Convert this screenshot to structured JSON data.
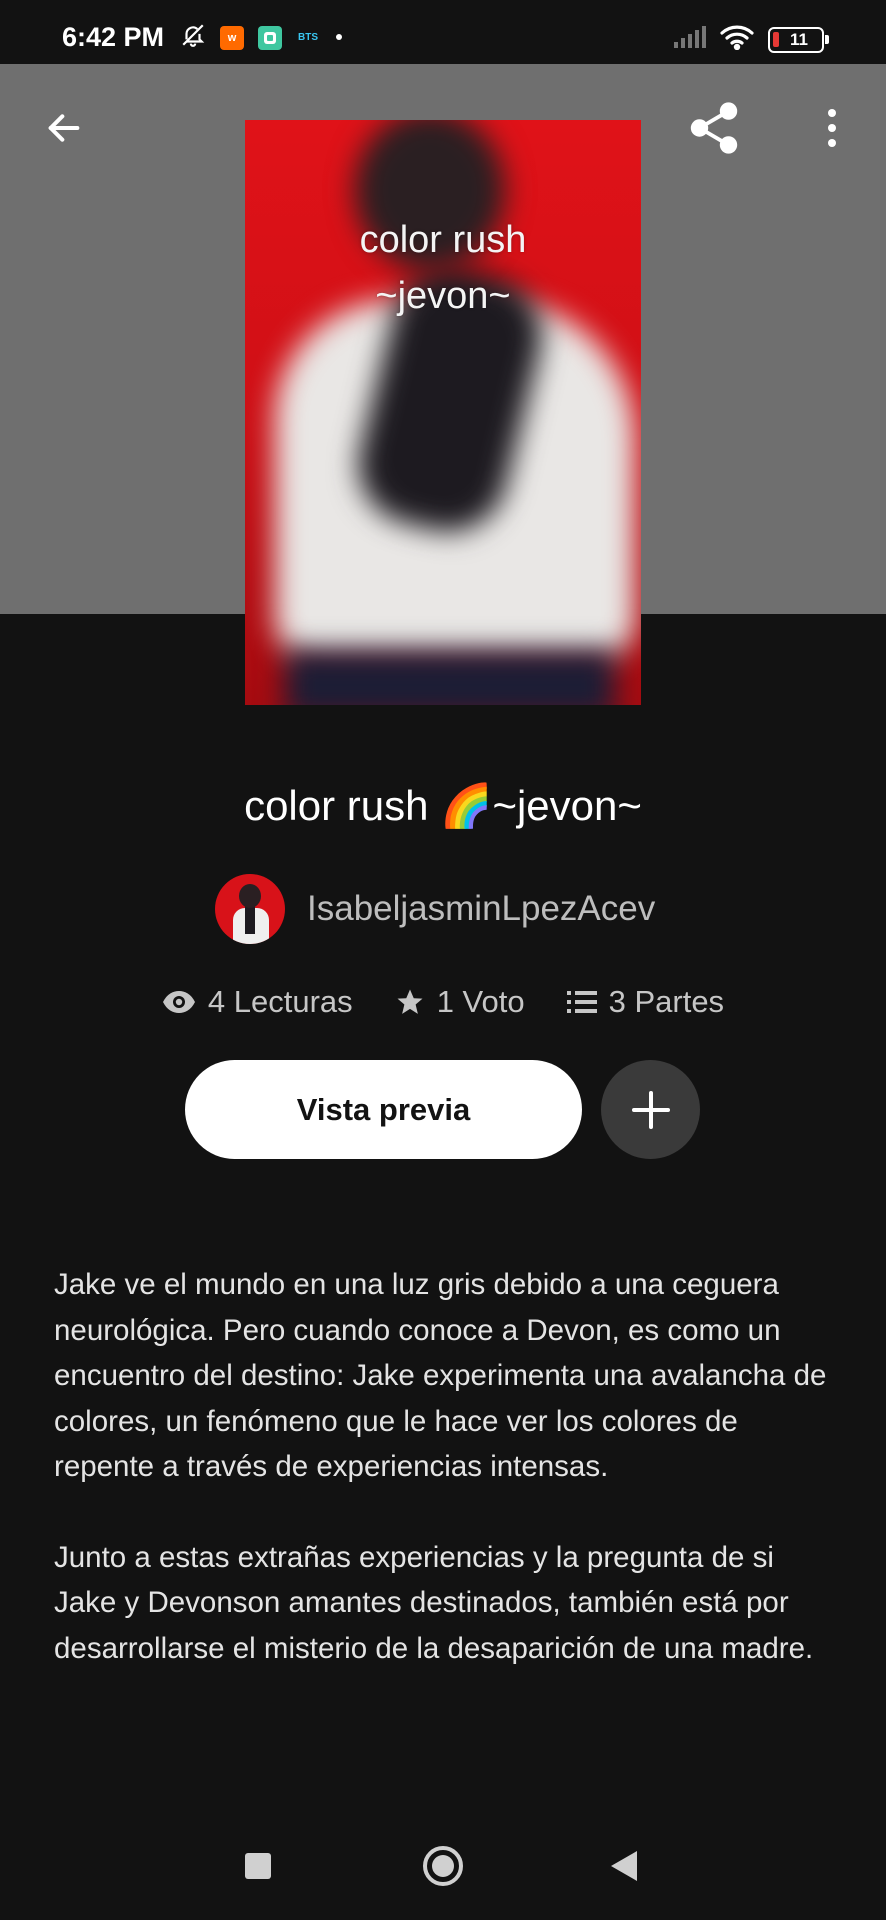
{
  "status_bar": {
    "time": "6:42 PM",
    "battery_level": "11",
    "app_icons": [
      "mute-icon",
      "app-w-icon",
      "app-green-icon",
      "bts-icon",
      "dot-icon"
    ],
    "app_w_label": "w",
    "bts_label": "BTS"
  },
  "header": {
    "back_icon": "arrow-left-icon",
    "share_icon": "share-icon",
    "more_icon": "more-vertical-icon"
  },
  "cover": {
    "line1": "color rush",
    "line2": "~jevon~"
  },
  "story": {
    "title": "color rush 🌈~jevon~",
    "author": "IsabeljasminLpezAcev"
  },
  "stats": {
    "reads": "4 Lecturas",
    "votes": "1 Voto",
    "parts": "3 Partes"
  },
  "actions": {
    "preview_label": "Vista previa",
    "add_icon": "plus-icon"
  },
  "description": {
    "paragraph1": "Jake ve el mundo en una luz gris debido a una ceguera neurológica. Pero cuando conoce a Devon, es como un encuentro del destino: Jake experimenta una avalancha de colores, un fenómeno que le hace ver los colores de repente a través de experiencias intensas.",
    "paragraph2": "Junto a estas extrañas experiencias y la pregunta de si Jake y Devonson amantes destinados, también está por desarrollarse el misterio de la desaparición de una madre."
  },
  "colors": {
    "background": "#121212",
    "header_band": "#6f6f6f",
    "cover_red": "#e01218",
    "button_dark": "#3a3a3a"
  }
}
